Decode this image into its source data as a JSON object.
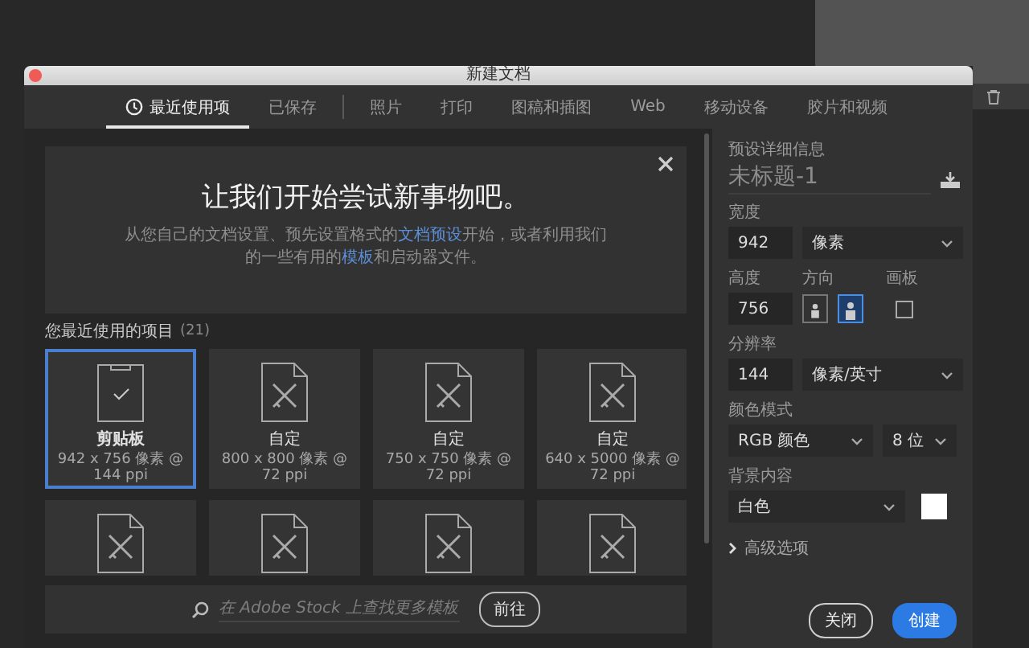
{
  "window": {
    "title": "新建文档"
  },
  "tab_groups": [
    {
      "tabs": [
        {
          "label": "最近使用项",
          "selected": true,
          "kind": "recent"
        },
        {
          "label": "已保存",
          "selected": false,
          "kind": "plain"
        }
      ]
    },
    {
      "tabs": [
        {
          "label": "照片",
          "selected": false,
          "kind": "plain"
        },
        {
          "label": "打印",
          "selected": false,
          "kind": "plain"
        },
        {
          "label": "图稿和插图",
          "selected": false,
          "kind": "plain"
        },
        {
          "label": "Web",
          "selected": false,
          "kind": "plain"
        },
        {
          "label": "移动设备",
          "selected": false,
          "kind": "plain"
        },
        {
          "label": "胶片和视频",
          "selected": false,
          "kind": "plain"
        }
      ]
    }
  ],
  "welcome": {
    "title": "让我们开始尝试新事物吧。",
    "text": [
      {
        "text": "从您自己的文档设置、预先设置格式的",
        "link": false
      },
      {
        "text": "文档预设",
        "link": true
      },
      {
        "text": "开始，或者利用我们的一些有用的",
        "link": false
      },
      {
        "text": "模板",
        "link": true
      },
      {
        "text": "和启动器文件。",
        "link": false
      }
    ]
  },
  "recent": {
    "heading": "您最近使用的项目",
    "count": "(21)",
    "items": [
      {
        "kind": "clipboard",
        "name": "剪贴板",
        "detail": "942 x 756 像素 @ 144 ppi",
        "selected": true
      },
      {
        "kind": "document",
        "name": "自定",
        "detail": "800 x 800 像素 @ 72 ppi",
        "selected": false
      },
      {
        "kind": "document",
        "name": "自定",
        "detail": "750 x 750 像素 @ 72 ppi",
        "selected": false
      },
      {
        "kind": "document",
        "name": "自定",
        "detail": "640 x 5000 像素 @ 72 ppi",
        "selected": false
      },
      {
        "kind": "document",
        "selected": false
      },
      {
        "kind": "document",
        "selected": false
      },
      {
        "kind": "document",
        "selected": false
      },
      {
        "kind": "document",
        "selected": false
      }
    ]
  },
  "stock_search": {
    "placeholder": "在 Adobe Stock 上查找更多模板",
    "button": "前往"
  },
  "preset": {
    "label": "预设详细信息",
    "name": "未标题-1",
    "width": {
      "label": "宽度",
      "value": "942",
      "unit": "像素"
    },
    "height": {
      "label": "高度",
      "value": "756"
    },
    "orientation": {
      "label": "方向",
      "options": [
        {
          "kind": "portrait",
          "selected": false
        },
        {
          "kind": "landscape",
          "selected": true
        }
      ]
    },
    "artboard": {
      "label": "画板",
      "checked": false
    },
    "resolution": {
      "label": "分辨率",
      "value": "144",
      "unit": "像素/英寸"
    },
    "color_mode": {
      "label": "颜色模式",
      "mode": "RGB 颜色",
      "depth": "8 位"
    },
    "background": {
      "label": "背景内容",
      "value": "白色",
      "color": "#ffffff"
    },
    "advanced": {
      "label": "高级选项",
      "expanded": false
    }
  },
  "buttons": {
    "close": "关闭",
    "create": "创建"
  }
}
